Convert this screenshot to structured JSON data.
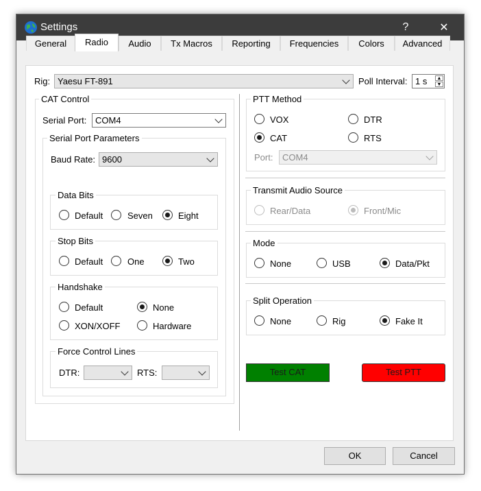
{
  "window": {
    "title": "Settings",
    "help": "?",
    "close": "✕"
  },
  "tabs": [
    "General",
    "Radio",
    "Audio",
    "Tx Macros",
    "Reporting",
    "Frequencies",
    "Colors",
    "Advanced"
  ],
  "rig": {
    "label": "Rig:",
    "value": "Yaesu FT-891"
  },
  "poll": {
    "label": "Poll Interval:",
    "value": "1 s"
  },
  "cat": {
    "title": "CAT Control",
    "serial_port_label": "Serial Port:",
    "serial_port_value": "COM4",
    "params_title": "Serial Port Parameters",
    "baud_label": "Baud Rate:",
    "baud_value": "9600",
    "data_bits": {
      "title": "Data Bits",
      "options": [
        "Default",
        "Seven",
        "Eight"
      ],
      "selected": "Eight"
    },
    "stop_bits": {
      "title": "Stop Bits",
      "options": [
        "Default",
        "One",
        "Two"
      ],
      "selected": "Two"
    },
    "handshake": {
      "title": "Handshake",
      "options": [
        "Default",
        "None",
        "XON/XOFF",
        "Hardware"
      ],
      "selected": "None"
    },
    "force": {
      "title": "Force Control Lines",
      "dtr_label": "DTR:",
      "rts_label": "RTS:"
    }
  },
  "ptt": {
    "title": "PTT Method",
    "options": [
      "VOX",
      "DTR",
      "CAT",
      "RTS"
    ],
    "selected": "CAT",
    "port_label": "Port:",
    "port_value": "COM4"
  },
  "tx_audio": {
    "title": "Transmit Audio Source",
    "options": [
      "Rear/Data",
      "Front/Mic"
    ],
    "selected": "Front/Mic"
  },
  "mode": {
    "title": "Mode",
    "options": [
      "None",
      "USB",
      "Data/Pkt"
    ],
    "selected": "Data/Pkt"
  },
  "split": {
    "title": "Split Operation",
    "options": [
      "None",
      "Rig",
      "Fake It"
    ],
    "selected": "Fake It"
  },
  "buttons": {
    "test_cat": "Test CAT",
    "test_ptt": "Test PTT",
    "ok": "OK",
    "cancel": "Cancel"
  },
  "colors": {
    "test_cat_bg": "#008000",
    "test_ptt_bg": "#ff0000",
    "titlebar": "#3c3c3c"
  },
  "icons": {
    "app": "globe-icon",
    "help": "question-icon",
    "close": "close-icon"
  }
}
